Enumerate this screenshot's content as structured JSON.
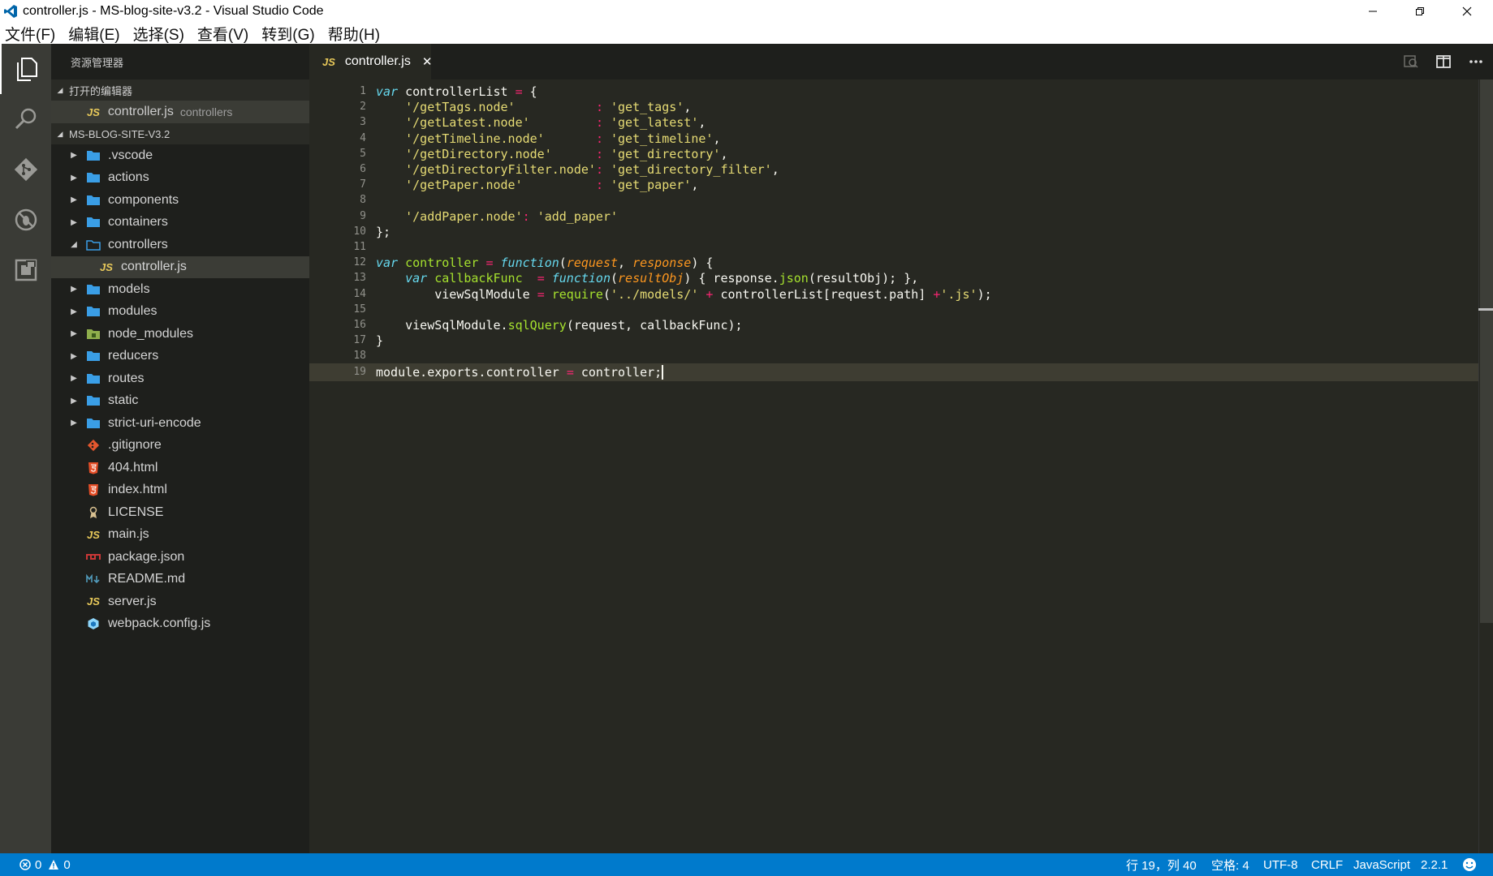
{
  "window": {
    "title": "controller.js - MS-blog-site-v3.2 - Visual Studio Code"
  },
  "menu": [
    "文件(F)",
    "编辑(E)",
    "选择(S)",
    "查看(V)",
    "转到(G)",
    "帮助(H)"
  ],
  "sidebar": {
    "header": "资源管理器",
    "open_editors_title": "打开的编辑器",
    "open_editor": {
      "name": "controller.js",
      "desc": "controllers"
    },
    "project_title": "MS-BLOG-SITE-V3.2",
    "tree": [
      {
        "name": ".vscode",
        "kind": "folder"
      },
      {
        "name": "actions",
        "kind": "folder"
      },
      {
        "name": "components",
        "kind": "folder"
      },
      {
        "name": "containers",
        "kind": "folder"
      },
      {
        "name": "controllers",
        "kind": "folder-open"
      },
      {
        "name": "controller.js",
        "kind": "js",
        "child": true,
        "selected": true
      },
      {
        "name": "models",
        "kind": "folder"
      },
      {
        "name": "modules",
        "kind": "folder"
      },
      {
        "name": "node_modules",
        "kind": "folder-node"
      },
      {
        "name": "reducers",
        "kind": "folder"
      },
      {
        "name": "routes",
        "kind": "folder"
      },
      {
        "name": "static",
        "kind": "folder"
      },
      {
        "name": "strict-uri-encode",
        "kind": "folder"
      },
      {
        "name": ".gitignore",
        "kind": "git"
      },
      {
        "name": "404.html",
        "kind": "html"
      },
      {
        "name": "index.html",
        "kind": "html"
      },
      {
        "name": "LICENSE",
        "kind": "license"
      },
      {
        "name": "main.js",
        "kind": "js"
      },
      {
        "name": "package.json",
        "kind": "npm"
      },
      {
        "name": "README.md",
        "kind": "md"
      },
      {
        "name": "server.js",
        "kind": "js"
      },
      {
        "name": "webpack.config.js",
        "kind": "webpack"
      }
    ]
  },
  "tab": {
    "name": "controller.js",
    "glyph": "JS",
    "close": "✕"
  },
  "code_lines": [
    [
      [
        "kw",
        "var"
      ],
      [
        "t",
        " controllerList "
      ],
      [
        "op",
        "="
      ],
      [
        "t",
        " {"
      ]
    ],
    [
      [
        "t",
        "    "
      ],
      [
        "str",
        "'/getTags.node'"
      ],
      [
        "t",
        "           "
      ],
      [
        "op",
        ":"
      ],
      [
        "t",
        " "
      ],
      [
        "str",
        "'get_tags'"
      ],
      [
        "t",
        ","
      ]
    ],
    [
      [
        "t",
        "    "
      ],
      [
        "str",
        "'/getLatest.node'"
      ],
      [
        "t",
        "         "
      ],
      [
        "op",
        ":"
      ],
      [
        "t",
        " "
      ],
      [
        "str",
        "'get_latest'"
      ],
      [
        "t",
        ","
      ]
    ],
    [
      [
        "t",
        "    "
      ],
      [
        "str",
        "'/getTimeline.node'"
      ],
      [
        "t",
        "       "
      ],
      [
        "op",
        ":"
      ],
      [
        "t",
        " "
      ],
      [
        "str",
        "'get_timeline'"
      ],
      [
        "t",
        ","
      ]
    ],
    [
      [
        "t",
        "    "
      ],
      [
        "str",
        "'/getDirectory.node'"
      ],
      [
        "t",
        "      "
      ],
      [
        "op",
        ":"
      ],
      [
        "t",
        " "
      ],
      [
        "str",
        "'get_directory'"
      ],
      [
        "t",
        ","
      ]
    ],
    [
      [
        "t",
        "    "
      ],
      [
        "str",
        "'/getDirectoryFilter.node'"
      ],
      [
        "op",
        ":"
      ],
      [
        "t",
        " "
      ],
      [
        "str",
        "'get_directory_filter'"
      ],
      [
        "t",
        ","
      ]
    ],
    [
      [
        "t",
        "    "
      ],
      [
        "str",
        "'/getPaper.node'"
      ],
      [
        "t",
        "          "
      ],
      [
        "op",
        ":"
      ],
      [
        "t",
        " "
      ],
      [
        "str",
        "'get_paper'"
      ],
      [
        "t",
        ","
      ]
    ],
    [],
    [
      [
        "t",
        "    "
      ],
      [
        "str",
        "'/addPaper.node'"
      ],
      [
        "op",
        ":"
      ],
      [
        "t",
        " "
      ],
      [
        "str",
        "'add_paper'"
      ]
    ],
    [
      [
        "t",
        "};"
      ]
    ],
    [],
    [
      [
        "kw",
        "var"
      ],
      [
        "t",
        " "
      ],
      [
        "fn",
        "controller"
      ],
      [
        "t",
        " "
      ],
      [
        "op",
        "="
      ],
      [
        "t",
        " "
      ],
      [
        "kw",
        "function"
      ],
      [
        "t",
        "("
      ],
      [
        "par",
        "request"
      ],
      [
        "t",
        ", "
      ],
      [
        "par",
        "response"
      ],
      [
        "t",
        ") {"
      ]
    ],
    [
      [
        "t",
        "    "
      ],
      [
        "kw",
        "var"
      ],
      [
        "t",
        " "
      ],
      [
        "fn",
        "callbackFunc"
      ],
      [
        "t",
        "  "
      ],
      [
        "op",
        "="
      ],
      [
        "t",
        " "
      ],
      [
        "kw",
        "function"
      ],
      [
        "t",
        "("
      ],
      [
        "par",
        "resultObj"
      ],
      [
        "t",
        ") { response."
      ],
      [
        "fn",
        "json"
      ],
      [
        "t",
        "(resultObj); },"
      ]
    ],
    [
      [
        "t",
        "        viewSqlModule "
      ],
      [
        "op",
        "="
      ],
      [
        "t",
        " "
      ],
      [
        "fn",
        "require"
      ],
      [
        "t",
        "("
      ],
      [
        "str",
        "'../models/'"
      ],
      [
        "t",
        " "
      ],
      [
        "op",
        "+"
      ],
      [
        "t",
        " controllerList[request.path] "
      ],
      [
        "op",
        "+"
      ],
      [
        "str",
        "'.js'"
      ],
      [
        "t",
        ");"
      ]
    ],
    [],
    [
      [
        "t",
        "    viewSqlModule."
      ],
      [
        "fn",
        "sqlQuery"
      ],
      [
        "t",
        "(request, callbackFunc);"
      ]
    ],
    [
      [
        "t",
        "}"
      ]
    ],
    [],
    [
      [
        "t",
        "module.exports.controller "
      ],
      [
        "op",
        "="
      ],
      [
        "t",
        " controller;"
      ]
    ]
  ],
  "cursor_line": 19,
  "status": {
    "errors": "0",
    "warnings": "0",
    "position": "行 19，列 40",
    "indent": "空格: 4",
    "encoding": "UTF-8",
    "eol": "CRLF",
    "language": "JavaScript",
    "version": "2.2.1"
  },
  "colors": {
    "status_bar": "#007acc",
    "editor_bg": "#272822",
    "sidebar_bg": "#1e1f1c",
    "activity_bg": "#3a3b36",
    "folder": "#3a9ee6",
    "js": "#e8c95a"
  }
}
